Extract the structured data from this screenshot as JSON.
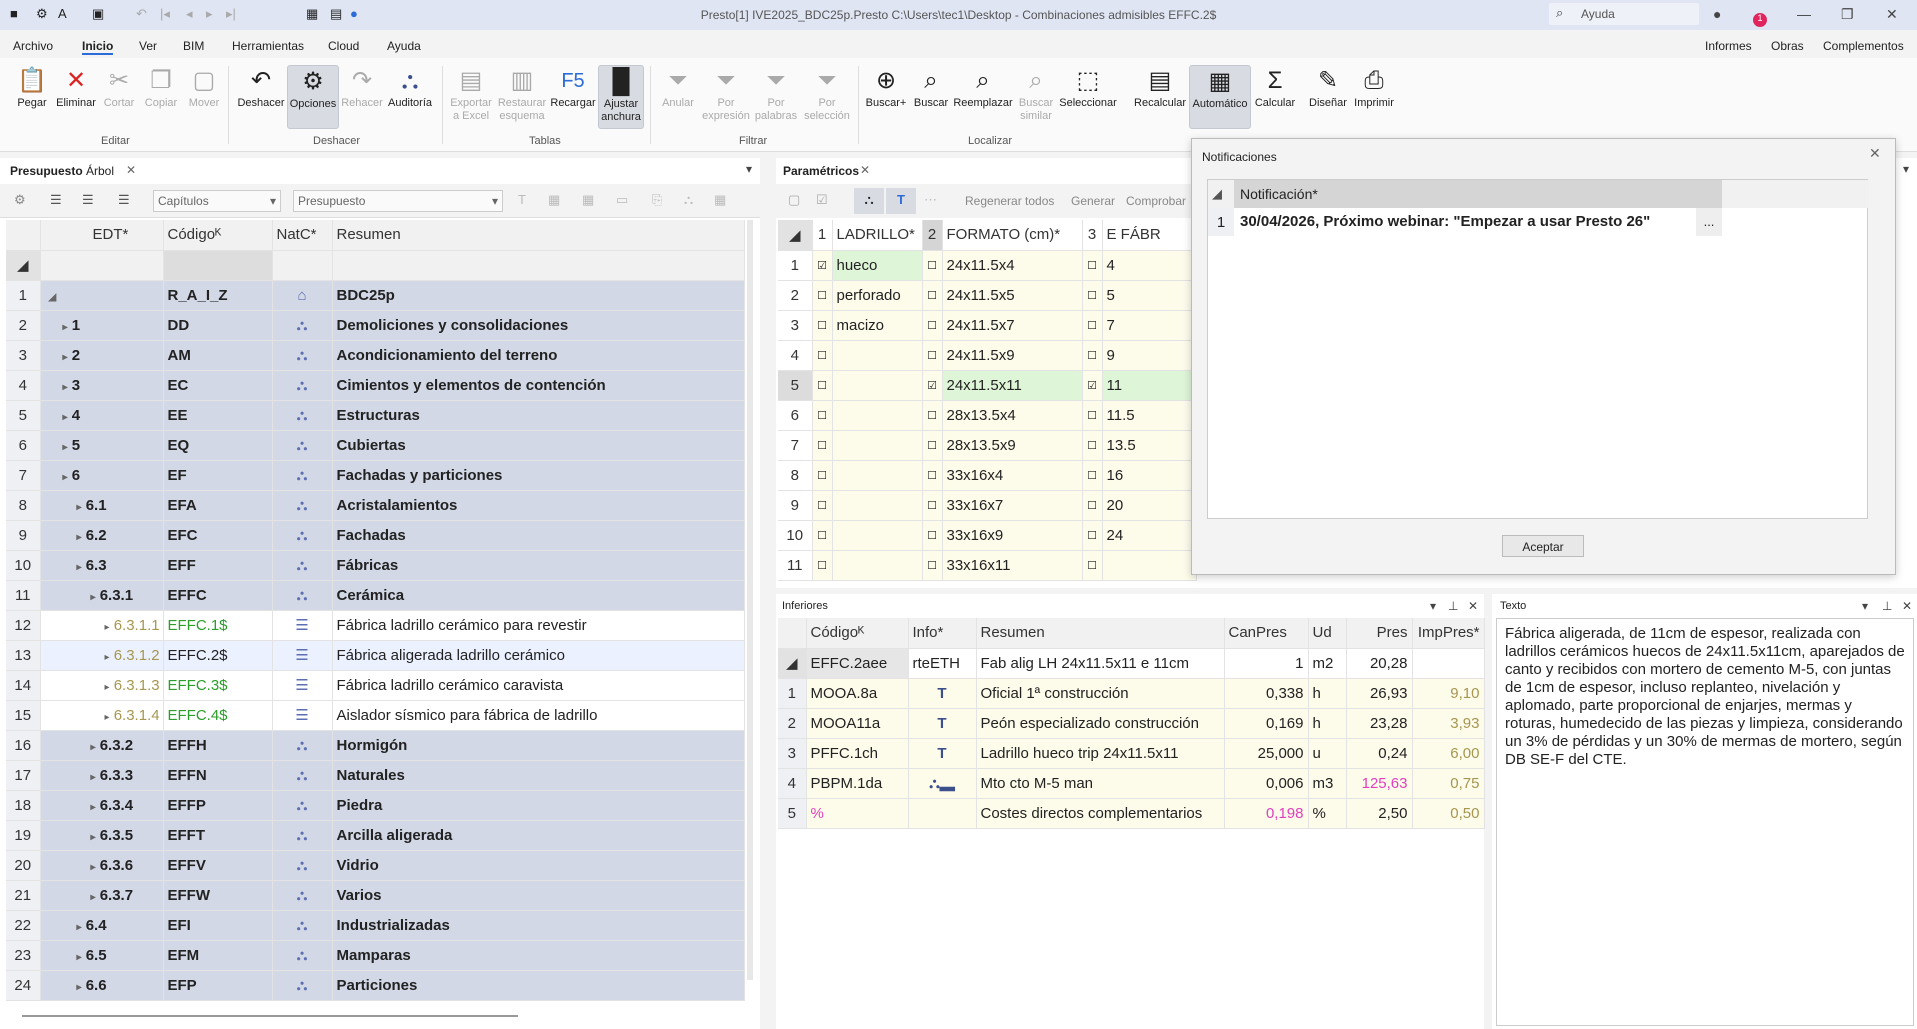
{
  "window": {
    "title": "Presto[1] IVE2025_BDC25p.Presto C:\\Users\\tec1\\Desktop - Combinaciones admisibles EFFC.2$",
    "help_label": "Ayuda",
    "notif_badge": "1"
  },
  "menu": [
    "Archivo",
    "Inicio",
    "Ver",
    "BIM",
    "Herramientas",
    "Cloud",
    "Ayuda"
  ],
  "menu_right": [
    "Informes",
    "Obras",
    "Complementos"
  ],
  "ribbon": {
    "buttons": [
      {
        "label": "Pegar"
      },
      {
        "label": "Eliminar"
      },
      {
        "label": "Cortar"
      },
      {
        "label": "Copiar"
      },
      {
        "label": "Mover"
      },
      {
        "label": "Deshacer"
      },
      {
        "label": "Opciones"
      },
      {
        "label": "Rehacer"
      },
      {
        "label": "Auditoría"
      },
      {
        "label": "Exportar a Excel"
      },
      {
        "label": "Restaurar esquema"
      },
      {
        "label": "Recargar"
      },
      {
        "label": "Ajustar anchura"
      },
      {
        "label": "Anular"
      },
      {
        "label": "Por expresión"
      },
      {
        "label": "Por palabras"
      },
      {
        "label": "Por selección"
      },
      {
        "label": "Buscar+"
      },
      {
        "label": "Buscar"
      },
      {
        "label": "Reemplazar"
      },
      {
        "label": "Buscar similar"
      },
      {
        "label": "Seleccionar"
      },
      {
        "label": "Recalcular"
      },
      {
        "label": "Automático"
      },
      {
        "label": "Calcular"
      },
      {
        "label": "Diseñar"
      },
      {
        "label": "Imprimir"
      }
    ],
    "groups": [
      "Editar",
      "Deshacer",
      "Tablas",
      "Filtrar",
      "Localizar"
    ]
  },
  "left_panel": {
    "tabs": [
      "Presupuesto",
      "Árbol"
    ],
    "filter1": "Capítulos",
    "filter2": "Presupuesto",
    "columns": [
      "EDT*",
      "Códigoᴷ",
      "NatC*",
      "Resumen"
    ],
    "rows": [
      {
        "n": "1",
        "edt": "",
        "code": "R_A_I_Z",
        "res": "BDC25p",
        "type": "root"
      },
      {
        "n": "2",
        "edt": "1",
        "code": "DD",
        "res": "Demoliciones y consolidaciones",
        "type": "chap"
      },
      {
        "n": "3",
        "edt": "2",
        "code": "AM",
        "res": "Acondicionamiento del terreno",
        "type": "chap"
      },
      {
        "n": "4",
        "edt": "3",
        "code": "EC",
        "res": "Cimientos y elementos de contención",
        "type": "chap"
      },
      {
        "n": "5",
        "edt": "4",
        "code": "EE",
        "res": "Estructuras",
        "type": "chap"
      },
      {
        "n": "6",
        "edt": "5",
        "code": "EQ",
        "res": "Cubiertas",
        "type": "chap"
      },
      {
        "n": "7",
        "edt": "6",
        "code": "EF",
        "res": "Fachadas y particiones",
        "type": "chap"
      },
      {
        "n": "8",
        "edt": "6.1",
        "code": "EFA",
        "res": "Acristalamientos",
        "type": "chap"
      },
      {
        "n": "9",
        "edt": "6.2",
        "code": "EFC",
        "res": "Fachadas",
        "type": "chap"
      },
      {
        "n": "10",
        "edt": "6.3",
        "code": "EFF",
        "res": "Fábricas",
        "type": "chap"
      },
      {
        "n": "11",
        "edt": "6.3.1",
        "code": "EFFC",
        "res": "Cerámica",
        "type": "chap"
      },
      {
        "n": "12",
        "edt": "6.3.1.1",
        "code": "EFFC.1$",
        "res": "Fábrica ladrillo cerámico para revestir",
        "type": "item"
      },
      {
        "n": "13",
        "edt": "6.3.1.2",
        "code": "EFFC.2$",
        "res": "Fábrica aligerada ladrillo cerámico",
        "type": "sel"
      },
      {
        "n": "14",
        "edt": "6.3.1.3",
        "code": "EFFC.3$",
        "res": "Fábrica ladrillo cerámico caravista",
        "type": "item"
      },
      {
        "n": "15",
        "edt": "6.3.1.4",
        "code": "EFFC.4$",
        "res": "Aislador sísmico para fábrica de ladrillo",
        "type": "item"
      },
      {
        "n": "16",
        "edt": "6.3.2",
        "code": "EFFH",
        "res": "Hormigón",
        "type": "chap"
      },
      {
        "n": "17",
        "edt": "6.3.3",
        "code": "EFFN",
        "res": "Naturales",
        "type": "chap"
      },
      {
        "n": "18",
        "edt": "6.3.4",
        "code": "EFFP",
        "res": "Piedra",
        "type": "chap"
      },
      {
        "n": "19",
        "edt": "6.3.5",
        "code": "EFFT",
        "res": "Arcilla aligerada",
        "type": "chap"
      },
      {
        "n": "20",
        "edt": "6.3.6",
        "code": "EFFV",
        "res": "Vidrio",
        "type": "chap"
      },
      {
        "n": "21",
        "edt": "6.3.7",
        "code": "EFFW",
        "res": "Varios",
        "type": "chap"
      },
      {
        "n": "22",
        "edt": "6.4",
        "code": "EFI",
        "res": "Industrializadas",
        "type": "chap"
      },
      {
        "n": "23",
        "edt": "6.5",
        "code": "EFM",
        "res": "Mamparas",
        "type": "chap"
      },
      {
        "n": "24",
        "edt": "6.6",
        "code": "EFP",
        "res": "Particiones",
        "type": "chap"
      }
    ]
  },
  "param_panel": {
    "tab": "Paramétricos",
    "toolbar": [
      "Regenerar todos",
      "Generar",
      "Comprobar"
    ],
    "headers": [
      {
        "num": "1",
        "label": "LADRILLO*"
      },
      {
        "num": "2",
        "label": "FORMATO (cm)*"
      },
      {
        "num": "3",
        "label": "E FÁBR"
      }
    ],
    "rows": [
      {
        "n": "1",
        "a": "hueco",
        "b": "24x11.5x4",
        "c": "4"
      },
      {
        "n": "2",
        "a": "perforado",
        "b": "24x11.5x5",
        "c": "5"
      },
      {
        "n": "3",
        "a": "macizo",
        "b": "24x11.5x7",
        "c": "7"
      },
      {
        "n": "4",
        "a": "",
        "b": "24x11.5x9",
        "c": "9"
      },
      {
        "n": "5",
        "a": "",
        "b": "24x11.5x11",
        "c": "11"
      },
      {
        "n": "6",
        "a": "",
        "b": "28x13.5x4",
        "c": "11.5"
      },
      {
        "n": "7",
        "a": "",
        "b": "28x13.5x9",
        "c": "13.5"
      },
      {
        "n": "8",
        "a": "",
        "b": "33x16x4",
        "c": "16"
      },
      {
        "n": "9",
        "a": "",
        "b": "33x16x7",
        "c": "20"
      },
      {
        "n": "10",
        "a": "",
        "b": "33x16x9",
        "c": "24"
      },
      {
        "n": "11",
        "a": "",
        "b": "33x16x11",
        "c": ""
      }
    ]
  },
  "notifications": {
    "title": "Notificaciones",
    "column": "Notificación*",
    "rows": [
      {
        "n": "1",
        "text": "30/04/2026, Próximo webinar: \"Empezar a usar Presto 26\"",
        "more": "..."
      }
    ],
    "accept": "Aceptar"
  },
  "inferiores": {
    "title": "Inferiores",
    "columns": [
      "Códigoᴷ",
      "Info*",
      "Resumen",
      "CanPres",
      "Ud",
      "Pres",
      "ImpPres*"
    ],
    "parent": {
      "code": "EFFC.2aee",
      "info": "rteETH",
      "res": "Fab alig LH 24x11.5x11 e 11cm",
      "can": "1",
      "ud": "m2",
      "pres": "20,28",
      "imp": ""
    },
    "rows": [
      {
        "n": "1",
        "code": "MOOA.8a",
        "res": "Oficial 1ª construcción",
        "can": "0,338",
        "ud": "h",
        "pres": "26,93",
        "imp": "9,10"
      },
      {
        "n": "2",
        "code": "MOOA11a",
        "res": "Peón especializado construcción",
        "can": "0,169",
        "ud": "h",
        "pres": "23,28",
        "imp": "3,93"
      },
      {
        "n": "3",
        "code": "PFFC.1ch",
        "res": "Ladrillo hueco trip 24x11.5x11",
        "can": "25,000",
        "ud": "u",
        "pres": "0,24",
        "imp": "6,00"
      },
      {
        "n": "4",
        "code": "PBPM.1da",
        "res": "Mto cto M-5 man",
        "can": "0,006",
        "ud": "m3",
        "pres": "125,63",
        "imp": "0,75"
      },
      {
        "n": "5",
        "code": "%",
        "res": "Costes directos complementarios",
        "can": "0,198",
        "ud": "%",
        "pres": "2,50",
        "imp": "0,50"
      }
    ]
  },
  "texto": {
    "title": "Texto",
    "body": "Fábrica aligerada, de 11cm de espesor, realizada con ladrillos cerámicos huecos de 24x11.5x11cm, aparejados de canto y recibidos con mortero de cemento M-5, con juntas de 1cm de espesor, incluso replanteo, nivelación y aplomado, parte proporcional de enjarjes, mermas y roturas, humedecido de las piezas y limpieza, considerando un 3% de pérdidas y un 30% de mermas de mortero, según DB SE-F del CTE."
  }
}
